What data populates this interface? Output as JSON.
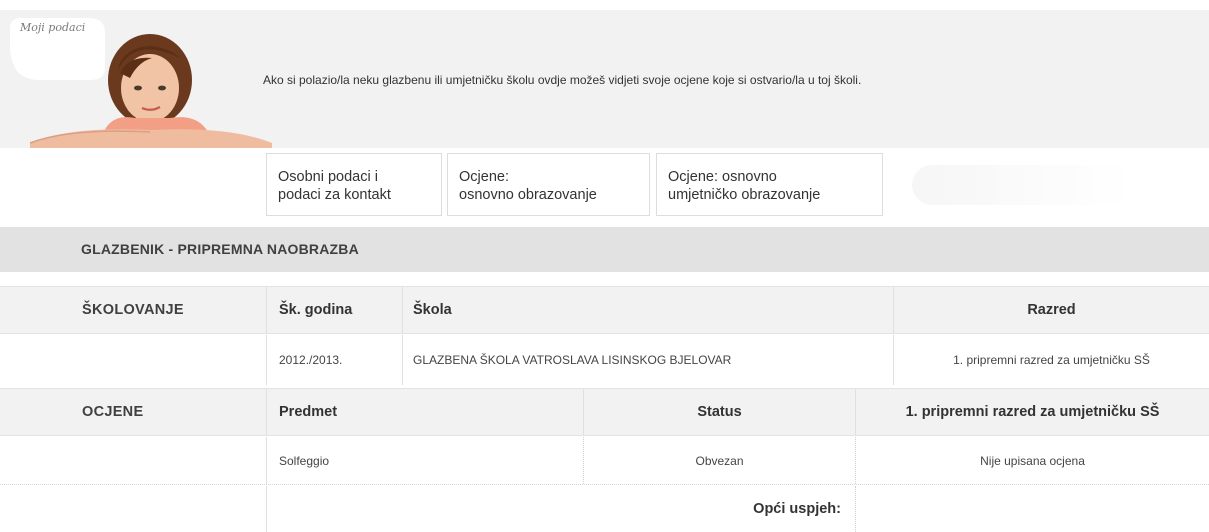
{
  "header": {
    "bubble_label": "Moji podaci",
    "intro_text": "Ako si polazio/la neku glazbenu ili umjetničku školu ovdje možeš vidjeti svoje ocjene koje si ostvario/la u toj školi."
  },
  "tabs": [
    {
      "line1": "Osobni podaci i",
      "line2": "podaci za kontakt"
    },
    {
      "line1": "Ocjene:",
      "line2": "osnovno obrazovanje"
    },
    {
      "line1": "Ocjene: osnovno",
      "line2": "umjetničko obrazovanje"
    }
  ],
  "section": {
    "title": "GLAZBENIK - PRIPREMNA NAOBRAZBA"
  },
  "schooling": {
    "label": "ŠKOLOVANJE",
    "headers": {
      "year": "Šk. godina",
      "school": "Škola",
      "grade": "Razred"
    },
    "rows": [
      {
        "year": "2012./2013.",
        "school": "GLAZBENA ŠKOLA VATROSLAVA LISINSKOG BJELOVAR",
        "grade": "1. pripremni razred za umjetničku SŠ"
      }
    ]
  },
  "grades": {
    "label": "OCJENE",
    "headers": {
      "subject": "Predmet",
      "status": "Status",
      "grade": "1. pripremni razred za umjetničku SŠ"
    },
    "rows": [
      {
        "subject": "Solfeggio",
        "status": "Obvezan",
        "grade": "Nije upisana ocjena"
      }
    ],
    "overall_label": "Opći uspjeh:",
    "overall_value": ""
  },
  "colors": {
    "header_bg": "#f2f2f2",
    "section_bg": "#e2e2e2",
    "border": "#e0e0e0"
  }
}
